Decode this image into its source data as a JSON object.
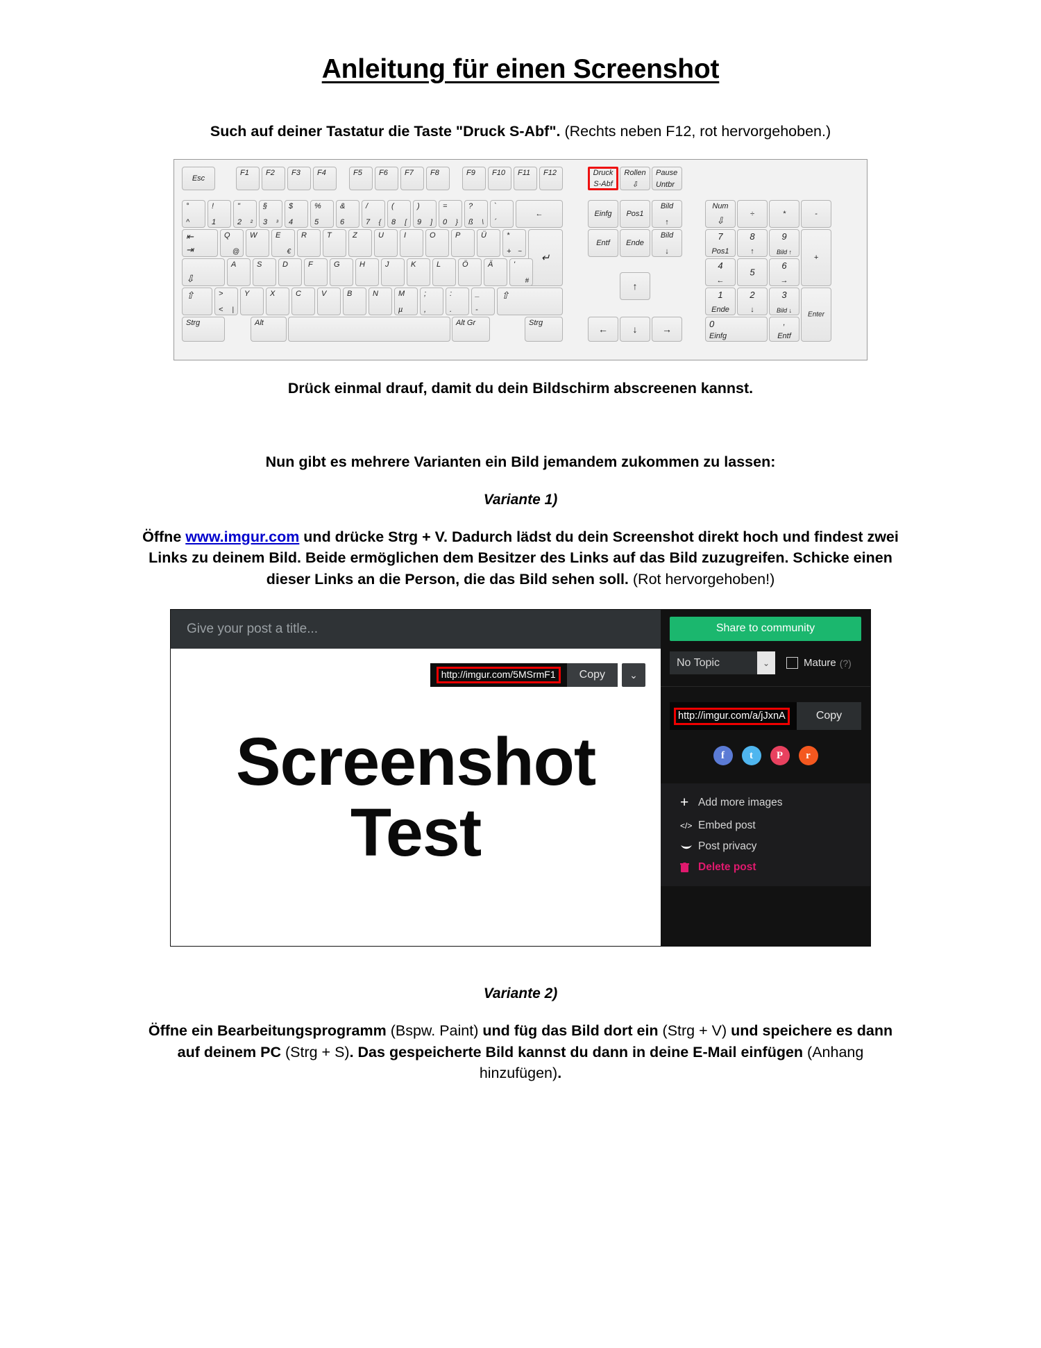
{
  "document": {
    "title": "Anleitung für einen Screenshot",
    "step1_bold": "Such auf deiner Tastatur die Taste \"Druck S-Abf\".",
    "step1_light": "(Rechts neben F12, rot hervorgehoben.)",
    "step2": "Drück einmal drauf, damit du dein Bildschirm abscreenen kannst.",
    "step3": "Nun gibt es mehrere Varianten ein Bild jemandem zukommen zu lassen:",
    "variant1_heading": "Variante 1)",
    "variant1_part1": "Öffne ",
    "variant1_link": "www.imgur.com",
    "variant1_part2": " und drücke Strg + V. Dadurch lädst du dein Screenshot direkt hoch und findest zwei Links zu deinem Bild. Beide ermöglichen dem Besitzer des Links auf das Bild zuzugreifen. Schicke einen dieser Links an die Person, die das Bild sehen soll.",
    "variant1_light": " (Rot hervorgehoben!)",
    "variant2_heading": "Variante 2)",
    "variant2_b1": "Öffne ein Bearbeitungsprogramm ",
    "variant2_l1": "(Bspw. Paint)",
    "variant2_b2": " und füg das Bild dort ein ",
    "variant2_l2": "(Strg + V)",
    "variant2_b3": " und speichere es dann auf deinem PC ",
    "variant2_l3": "(Strg + S)",
    "variant2_b4": ". Das gespeicherte Bild kannst du dann in deine E-Mail einfügen ",
    "variant2_l4": "(Anhang hinzufügen)",
    "variant2_b5": "."
  },
  "keyboard": {
    "highlight_color": "#ee1111",
    "highlighted_key": "Druck S-Abf",
    "row_fn": [
      {
        "label": "Esc"
      },
      {
        "label": "F1"
      },
      {
        "label": "F2"
      },
      {
        "label": "F3"
      },
      {
        "label": "F4"
      },
      {
        "label": "F5"
      },
      {
        "label": "F6"
      },
      {
        "label": "F7"
      },
      {
        "label": "F8"
      },
      {
        "label": "F9"
      },
      {
        "label": "F10"
      },
      {
        "label": "F11"
      },
      {
        "label": "F12"
      }
    ],
    "row_num": [
      {
        "top": "°",
        "bottom": "^"
      },
      {
        "top": "!",
        "bottom": "1"
      },
      {
        "top": "\"",
        "bottom": "2",
        "alt": "²"
      },
      {
        "top": "§",
        "bottom": "3",
        "alt": "³"
      },
      {
        "top": "$",
        "bottom": "4"
      },
      {
        "top": "%",
        "bottom": "5"
      },
      {
        "top": "&",
        "bottom": "6"
      },
      {
        "top": "/",
        "bottom": "7",
        "alt": "{"
      },
      {
        "top": "(",
        "bottom": "8",
        "alt": "["
      },
      {
        "top": ")",
        "bottom": "9",
        "alt": "]"
      },
      {
        "top": "=",
        "bottom": "0",
        "alt": "}"
      },
      {
        "top": "?",
        "bottom": "ß",
        "alt": "\\"
      },
      {
        "top": "`",
        "bottom": "´"
      },
      {
        "label": "←"
      }
    ],
    "row_q": [
      {
        "label": "tab"
      },
      {
        "top": "Q",
        "alt": "@"
      },
      {
        "top": "W"
      },
      {
        "top": "E",
        "alt": "€"
      },
      {
        "top": "R"
      },
      {
        "top": "T"
      },
      {
        "top": "Z"
      },
      {
        "top": "U"
      },
      {
        "top": "I"
      },
      {
        "top": "O"
      },
      {
        "top": "P"
      },
      {
        "top": "Ü"
      },
      {
        "top": "*",
        "bottom": "+",
        "alt": "~"
      },
      {
        "label": "↵"
      }
    ],
    "row_a": [
      {
        "label": "caps"
      },
      {
        "top": "A"
      },
      {
        "top": "S"
      },
      {
        "top": "D"
      },
      {
        "top": "F"
      },
      {
        "top": "G"
      },
      {
        "top": "H"
      },
      {
        "top": "J"
      },
      {
        "top": "K"
      },
      {
        "top": "L"
      },
      {
        "top": "Ö"
      },
      {
        "top": "Ä"
      },
      {
        "top": "'",
        "alt": "#"
      }
    ],
    "row_y": [
      {
        "label": "⇧"
      },
      {
        "top": ">",
        "bottom": "<",
        "alt": "|"
      },
      {
        "top": "Y"
      },
      {
        "top": "X"
      },
      {
        "top": "C"
      },
      {
        "top": "V"
      },
      {
        "top": "B"
      },
      {
        "top": "N"
      },
      {
        "top": "M",
        "bottom": "µ"
      },
      {
        "top": ";",
        "bottom": ","
      },
      {
        "top": ":",
        "bottom": "."
      },
      {
        "top": "_",
        "bottom": "-"
      },
      {
        "label": "⇧"
      }
    ],
    "row_space": [
      {
        "label": "Strg"
      },
      {
        "label": "Alt"
      },
      {
        "label": ""
      },
      {
        "label": "Alt Gr"
      },
      {
        "label": "Strg"
      }
    ],
    "cluster_top": [
      {
        "top": "Druck",
        "bottom": "S-Abf",
        "highlight": true
      },
      {
        "top": "Rollen",
        "bottom": "⇩"
      },
      {
        "top": "Pause",
        "bottom": "Untbr"
      }
    ],
    "cluster_nav": [
      {
        "label": "Einfg"
      },
      {
        "label": "Pos1"
      },
      {
        "top": "Bild",
        "bottom": "↑"
      },
      {
        "label": "Entf"
      },
      {
        "label": "Ende"
      },
      {
        "top": "Bild",
        "bottom": "↓"
      }
    ],
    "arrows": [
      {
        "label": "↑"
      },
      {
        "label": "←"
      },
      {
        "label": "↓"
      },
      {
        "label": "→"
      }
    ],
    "numpad": [
      {
        "top": "Num",
        "bottom": "⇩"
      },
      {
        "label": "÷"
      },
      {
        "label": "*"
      },
      {
        "label": "-"
      },
      {
        "top": "7",
        "bottom": "Pos1"
      },
      {
        "top": "8",
        "bottom": "↑"
      },
      {
        "top": "9",
        "bottom": "Bild ↑"
      },
      {
        "label": "+"
      },
      {
        "top": "4",
        "bottom": "←"
      },
      {
        "label": "5"
      },
      {
        "top": "6",
        "bottom": "→"
      },
      {
        "top": "1",
        "bottom": "Ende"
      },
      {
        "top": "2",
        "bottom": "↓"
      },
      {
        "top": "3",
        "bottom": "Bild ↓"
      },
      {
        "label": "Enter"
      },
      {
        "top": "0",
        "bottom": "Einfg"
      },
      {
        "top": ",",
        "bottom": "Entf"
      }
    ]
  },
  "imgur": {
    "title_placeholder": "Give your post a title...",
    "image_line1": "Screenshot",
    "image_line2": "Test",
    "direct_link": "http://imgur.com/5MSrmF1",
    "copy_label": "Copy",
    "caret_icon": "⌄",
    "share_button": "Share to community",
    "topic_value": "No Topic",
    "topic_caret": "⌄",
    "mature_label": "Mature",
    "mature_hint": "(?)",
    "album_link": "http://imgur.com/a/jJxnA",
    "album_copy_label": "Copy",
    "social": [
      {
        "name": "facebook",
        "glyph": "f",
        "color": "#5b7bd5"
      },
      {
        "name": "twitter",
        "glyph": "t",
        "color": "#4fb6ef"
      },
      {
        "name": "pinterest",
        "glyph": "P",
        "color": "#e8415f"
      },
      {
        "name": "reddit",
        "glyph": "r",
        "color": "#f4581f"
      }
    ],
    "menu": [
      {
        "icon": "plus-icon",
        "glyph": "+",
        "label": "Add more images",
        "danger": false
      },
      {
        "icon": "code-icon",
        "glyph": "</>",
        "label": "Embed post",
        "danger": false
      },
      {
        "icon": "eye-icon",
        "glyph": "👁",
        "label": "Post privacy",
        "danger": false
      },
      {
        "icon": "trash-icon",
        "glyph": "🗑",
        "label": "Delete post",
        "danger": true
      }
    ]
  }
}
